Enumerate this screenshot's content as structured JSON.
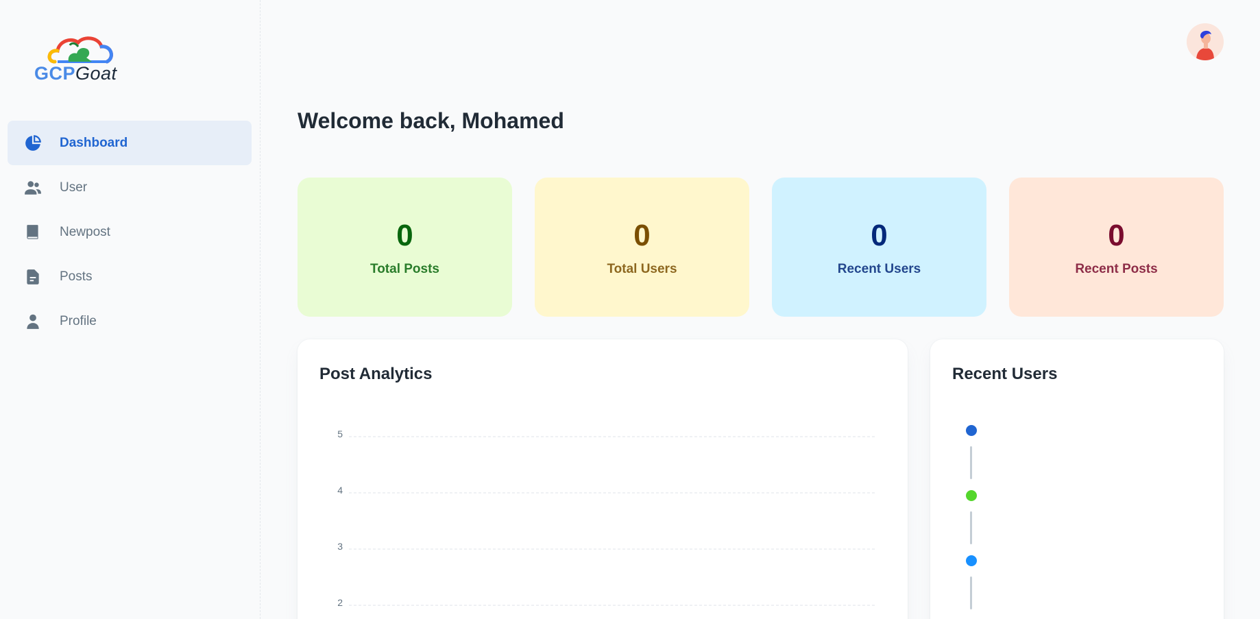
{
  "brand": {
    "part1": "GCP",
    "part2": "Goat"
  },
  "sidebar": {
    "items": [
      {
        "label": "Dashboard",
        "icon": "pie-chart-icon",
        "active": true
      },
      {
        "label": "User",
        "icon": "people-icon"
      },
      {
        "label": "Newpost",
        "icon": "book-icon"
      },
      {
        "label": "Posts",
        "icon": "file-text-icon"
      },
      {
        "label": "Profile",
        "icon": "person-icon"
      }
    ]
  },
  "header": {
    "welcome": "Welcome back, Mohamed"
  },
  "stats": [
    {
      "value": "0",
      "label": "Total Posts",
      "bg": "#e9fcd4",
      "color": "#08660d"
    },
    {
      "value": "0",
      "label": "Total Users",
      "bg": "#fff7cd",
      "color": "#7a4f01"
    },
    {
      "value": "0",
      "label": "Recent Users",
      "bg": "#d0f2ff",
      "color": "#04297a"
    },
    {
      "value": "0",
      "label": "Recent Posts",
      "bg": "#ffe7d9",
      "color": "#7a0c2e"
    }
  ],
  "analytics": {
    "title": "Post Analytics",
    "chart_data": {
      "type": "line",
      "title": "Post Analytics",
      "y_ticks": [
        "5",
        "4",
        "3",
        "2"
      ],
      "ylim": [
        2,
        5
      ],
      "grid": true,
      "series": []
    }
  },
  "recent_users": {
    "title": "Recent Users",
    "dot_colors": [
      "#2065d1",
      "#54d62c",
      "#1890ff"
    ]
  }
}
